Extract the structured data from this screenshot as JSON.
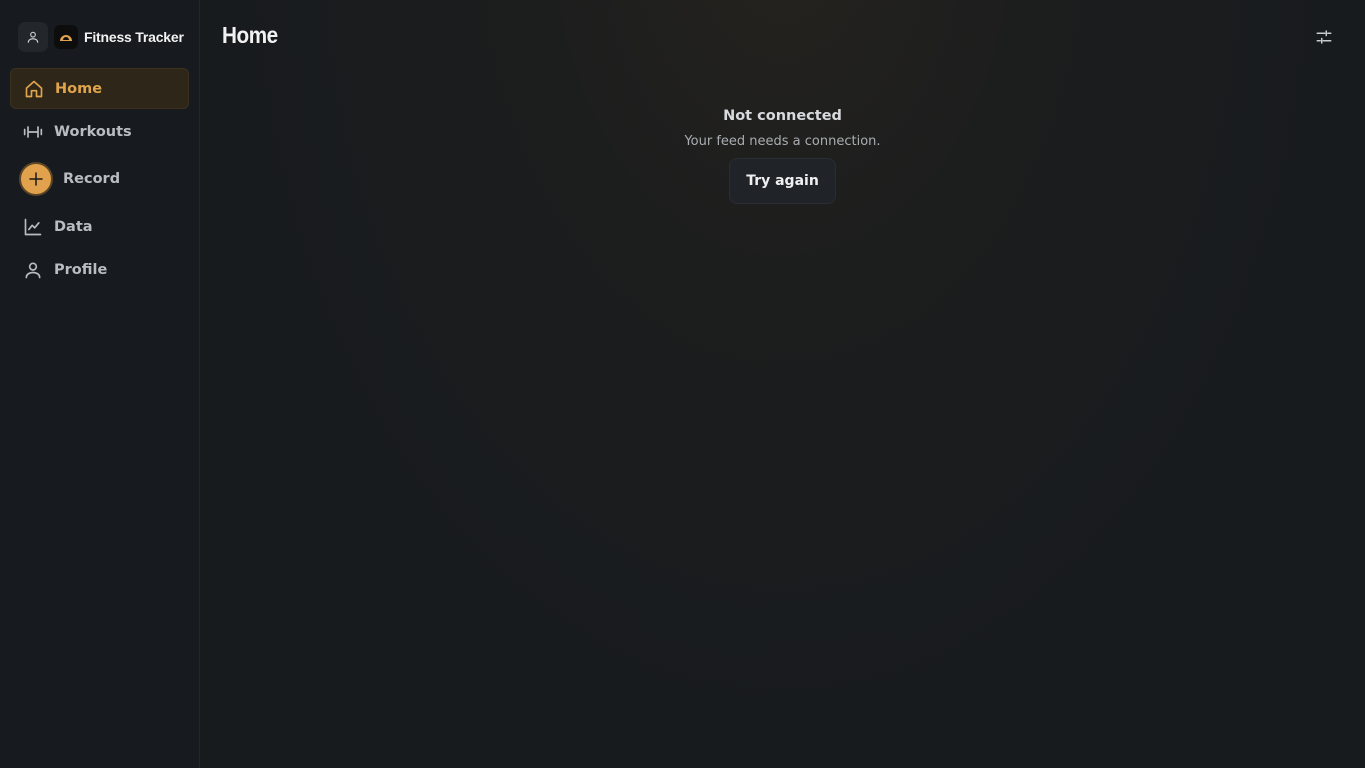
{
  "app": {
    "name": "Fitness Tracker"
  },
  "colors": {
    "accent": "#e2a24d",
    "background": "#171a1d",
    "sidebar": "#171b1f"
  },
  "sidebar": {
    "items": [
      {
        "label": "Home",
        "icon": "home-icon",
        "active": true
      },
      {
        "label": "Workouts",
        "icon": "dumbbell-icon",
        "active": false
      },
      {
        "label": "Record",
        "icon": "plus-icon",
        "active": false
      },
      {
        "label": "Data",
        "icon": "chart-line-icon",
        "active": false
      },
      {
        "label": "Profile",
        "icon": "user-icon",
        "active": false
      }
    ]
  },
  "header": {
    "title": "Home",
    "filter_icon": "sliders-icon"
  },
  "empty_state": {
    "title": "Not connected",
    "message": "Your feed needs a connection.",
    "button_label": "Try again"
  }
}
